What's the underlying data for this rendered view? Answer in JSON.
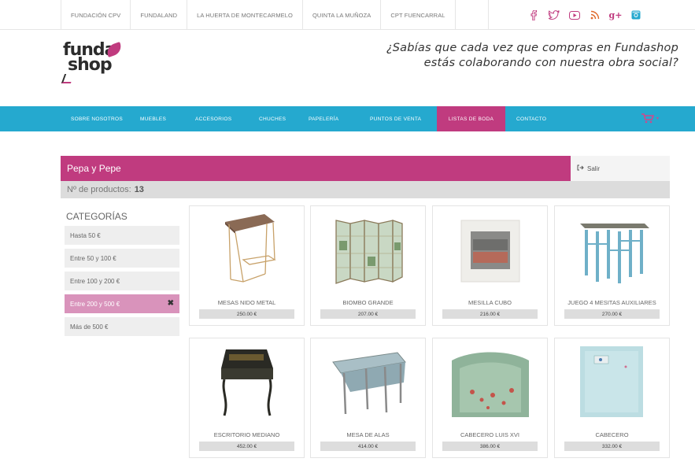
{
  "topbar": {
    "links": [
      "FUNDACIÓN CPV",
      "FUNDALAND",
      "LA HUERTA DE MONTECARMELO",
      "QUINTA LA MUÑOZA",
      "CPT FUENCARRAL"
    ]
  },
  "social": {
    "icons": [
      "facebook-icon",
      "twitter-icon",
      "youtube-icon",
      "rss-icon",
      "google-plus-icon",
      "instagram-icon"
    ],
    "colors": [
      "#c03b7f",
      "#c03b7f",
      "#c03b7f",
      "#e06a2b",
      "#c03b7f",
      "#25a9cf"
    ]
  },
  "logo": {
    "line1": "funda",
    "line2": "shop"
  },
  "tagline": {
    "line1": "¿Sabías que cada vez que compras en Fundashop",
    "line2": "estás colaborando con nuestra obra social?"
  },
  "nav": {
    "items": [
      "SOBRE NOSOTROS",
      "MUEBLES",
      "ACCESORIOS",
      "CHUCHES",
      "PAPELERÍA",
      "PUNTOS DE VENTA",
      "LISTAS DE BODA",
      "CONTACTO"
    ],
    "active_index": 6,
    "cart_icon": "shopping-cart-icon"
  },
  "colors": {
    "brand_pink": "#c03b7f",
    "nav_blue": "#25a9cf"
  },
  "list": {
    "title": "Pepa y Pepe",
    "exit_label": "Salir",
    "count_label": "Nº de productos:",
    "count_value": "13"
  },
  "sidebar": {
    "title": "CATEGORÍAS",
    "categories": [
      "Hasta 50 €",
      "Entre 50 y 100 €",
      "Entre 100 y 200 €",
      "Entre 200 y 500 €",
      "Más de 500 €"
    ],
    "active_index": 3,
    "clear_icon": "close-icon"
  },
  "products": [
    {
      "name": "MESAS NIDO METAL",
      "price": "250.00 €"
    },
    {
      "name": "BIOMBO GRANDE",
      "price": "207.00 €"
    },
    {
      "name": "MESILLA CUBO",
      "price": "216.00 €"
    },
    {
      "name": "JUEGO 4 MESITAS AUXILIARES",
      "price": "270.00 €"
    },
    {
      "name": "ESCRITORIO MEDIANO",
      "price": "452.00 €"
    },
    {
      "name": "MESA DE ALAS",
      "price": "414.00 €"
    },
    {
      "name": "CABECERO LUIS XVI",
      "price": "386.00 €"
    },
    {
      "name": "CABECERO",
      "price": "332.00 €"
    }
  ]
}
